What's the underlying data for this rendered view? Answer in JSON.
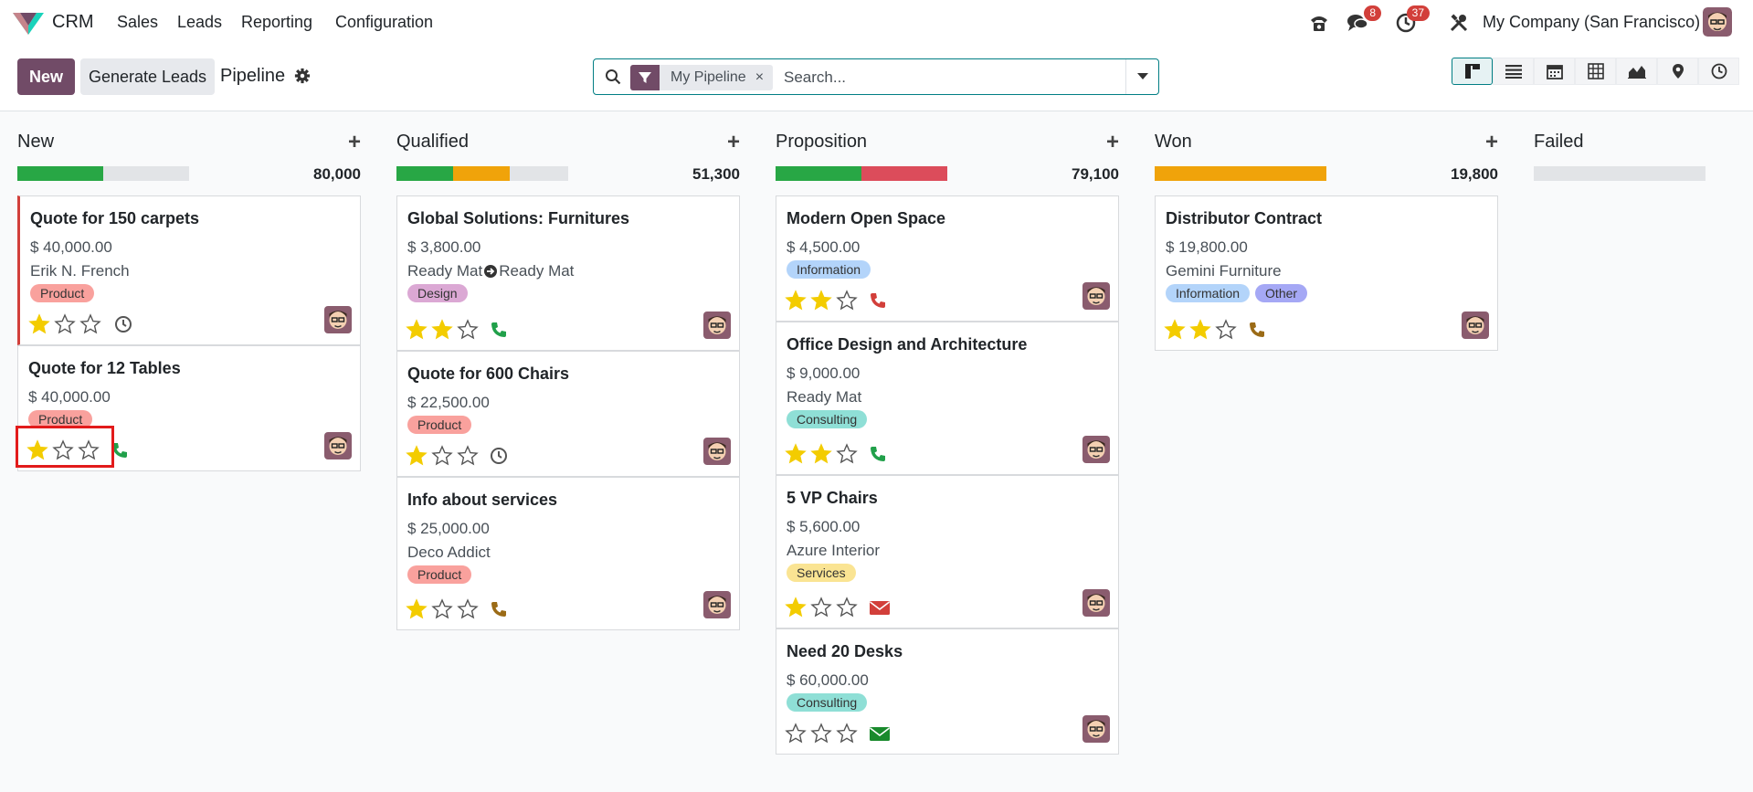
{
  "nav": {
    "app_name": "CRM",
    "menu": [
      "Sales",
      "Leads",
      "Reporting",
      "Configuration"
    ],
    "messages_count": "8",
    "activities_count": "37",
    "company": "My Company (San Francisco)"
  },
  "control": {
    "new_label": "New",
    "generate_label": "Generate Leads",
    "breadcrumb": "Pipeline",
    "facet_label": "My Pipeline",
    "facet_remove": "×",
    "search_placeholder": "Search..."
  },
  "colors": {
    "brand": "#714b67",
    "green": "#28a745",
    "orange": "#f0a30a",
    "red": "#dc4c5b",
    "grey": "#e2e4e7"
  },
  "columns": [
    {
      "name": "New",
      "total": "80,000",
      "progress": [
        {
          "color": "#28a745",
          "fraction": 0.5
        }
      ],
      "cards": [
        {
          "title": "Quote for 150 carpets",
          "amount": "$ 40,000.00",
          "partner": "Erik N. French",
          "tags": [
            {
              "label": "Product",
              "color": "#f9a19d"
            }
          ],
          "stars": 1,
          "activity": "clock-icon"
        },
        {
          "title": "Quote for 12 Tables",
          "amount": "$ 40,000.00",
          "partner": "",
          "tags": [
            {
              "label": "Product",
              "color": "#f9a19d"
            }
          ],
          "stars": 1,
          "activity": "phone-green-icon"
        }
      ]
    },
    {
      "name": "Qualified",
      "total": "51,300",
      "progress": [
        {
          "color": "#28a745",
          "fraction": 0.33
        },
        {
          "color": "#f0a30a",
          "fraction": 0.33
        }
      ],
      "cards": [
        {
          "title": "Global Solutions: Furnitures",
          "amount": "$ 3,800.00",
          "partner": "Ready Mat",
          "partner_suffix": "Ready Mat",
          "tags": [
            {
              "label": "Design",
              "color": "#dba8d4"
            }
          ],
          "stars": 2,
          "activity": "phone-green-icon"
        },
        {
          "title": "Quote for 600 Chairs",
          "amount": "$ 22,500.00",
          "partner": "",
          "tags": [
            {
              "label": "Product",
              "color": "#f9a19d"
            }
          ],
          "stars": 1,
          "activity": "clock-icon"
        },
        {
          "title": "Info about services",
          "amount": "$ 25,000.00",
          "partner": "Deco Addict",
          "tags": [
            {
              "label": "Product",
              "color": "#f9a19d"
            }
          ],
          "stars": 1,
          "activity": "phone-orange-icon"
        }
      ]
    },
    {
      "name": "Proposition",
      "total": "79,100",
      "progress": [
        {
          "color": "#28a745",
          "fraction": 0.5
        },
        {
          "color": "#dc4c5b",
          "fraction": 0.5
        }
      ],
      "cards": [
        {
          "title": "Modern Open Space",
          "amount": "$ 4,500.00",
          "partner": "",
          "tags": [
            {
              "label": "Information",
              "color": "#b3d4fa"
            }
          ],
          "stars": 2,
          "activity": "phone-red-icon"
        },
        {
          "title": "Office Design and Architecture",
          "amount": "$ 9,000.00",
          "partner": "Ready Mat",
          "tags": [
            {
              "label": "Consulting",
              "color": "#8fdfd6"
            }
          ],
          "stars": 2,
          "activity": "phone-green-icon"
        },
        {
          "title": "5 VP Chairs",
          "amount": "$ 5,600.00",
          "partner": "Azure Interior",
          "tags": [
            {
              "label": "Services",
              "color": "#fae493"
            }
          ],
          "stars": 1,
          "activity": "envelope-red-icon"
        },
        {
          "title": "Need 20 Desks",
          "amount": "$ 60,000.00",
          "partner": "",
          "tags": [
            {
              "label": "Consulting",
              "color": "#8fdfd6"
            }
          ],
          "stars": 0,
          "activity": "envelope-green-icon"
        }
      ]
    },
    {
      "name": "Won",
      "total": "19,800",
      "progress": [
        {
          "color": "#f0a30a",
          "fraction": 1.0
        }
      ],
      "cards": [
        {
          "title": "Distributor Contract",
          "amount": "$ 19,800.00",
          "partner": "Gemini Furniture",
          "tags": [
            {
              "label": "Information",
              "color": "#b3d4fa"
            },
            {
              "label": "Other",
              "color": "#a5a8f5"
            }
          ],
          "stars": 2,
          "activity": "phone-orange-icon"
        }
      ]
    },
    {
      "name": "Failed",
      "total": "",
      "progress": [],
      "cards": []
    }
  ]
}
